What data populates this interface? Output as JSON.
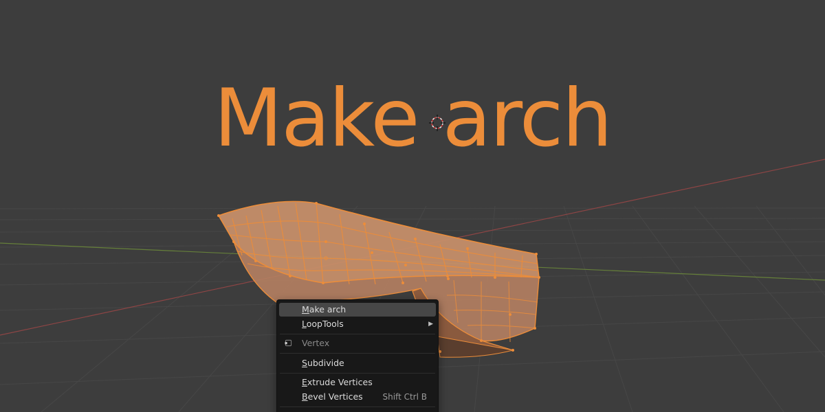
{
  "viewport": {
    "headline": "Make arch",
    "colors": {
      "background": "#3d3d3d",
      "accent": "#ec8d3a",
      "grid": "#474747",
      "axis_x": "#9b4a4a",
      "axis_y": "#6a8a3a"
    }
  },
  "context_menu": {
    "items": [
      {
        "label_first": "M",
        "label_rest": "ake arch",
        "active": true
      },
      {
        "label_first": "L",
        "label_rest": "oopTools",
        "has_submenu": true,
        "submenu_glyph": "▶"
      }
    ],
    "section_header": {
      "label": "Vertex",
      "icon": "vertex-mode-icon"
    },
    "subdivide": {
      "label_first": "S",
      "label_rest": "ubdivide"
    },
    "extrude": {
      "label_first": "E",
      "label_rest": "xtrude Vertices"
    },
    "bevel": {
      "label_first": "B",
      "label_rest": "evel Vertices",
      "shortcut": "Shift Ctrl B"
    }
  }
}
